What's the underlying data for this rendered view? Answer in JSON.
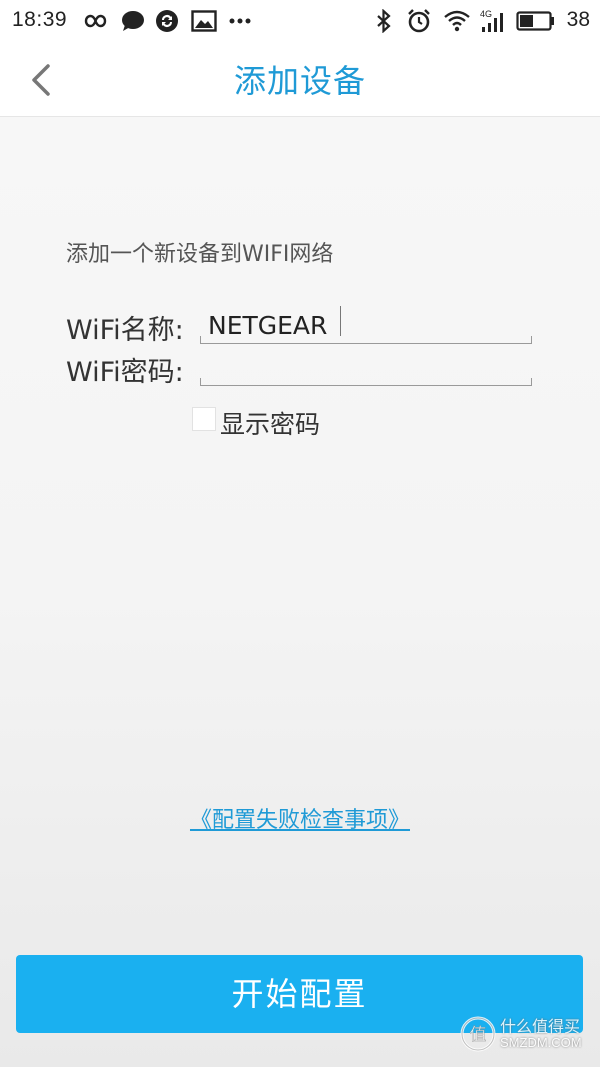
{
  "status_bar": {
    "time": "18:39",
    "network": "4G",
    "battery": "38",
    "icons": [
      "infinity-icon",
      "chat-bubble-icon",
      "sync-icon",
      "image-icon",
      "more-dots-icon",
      "bluetooth-icon",
      "alarm-icon",
      "wifi-icon",
      "signal-icon",
      "battery-icon"
    ]
  },
  "title_bar": {
    "back_icon": "chevron-left-icon",
    "title": "添加设备"
  },
  "content": {
    "instruction": "添加一个新设备到WIFI网络",
    "wifi_name_label": "WiFi名称:",
    "wifi_name_value": "NETGEAR",
    "wifi_password_label": "WiFi密码:",
    "wifi_password_value": "",
    "show_password_label": "显示密码",
    "show_password_checked": false,
    "troubleshoot_link": "《配置失败检查事项》"
  },
  "actions": {
    "start_button": "开始配置"
  },
  "watermark": {
    "line1": "什么值得买",
    "line2": "SMZDM.COM"
  },
  "colors": {
    "accent": "#1f9ad6",
    "button": "#1ab0f0"
  }
}
